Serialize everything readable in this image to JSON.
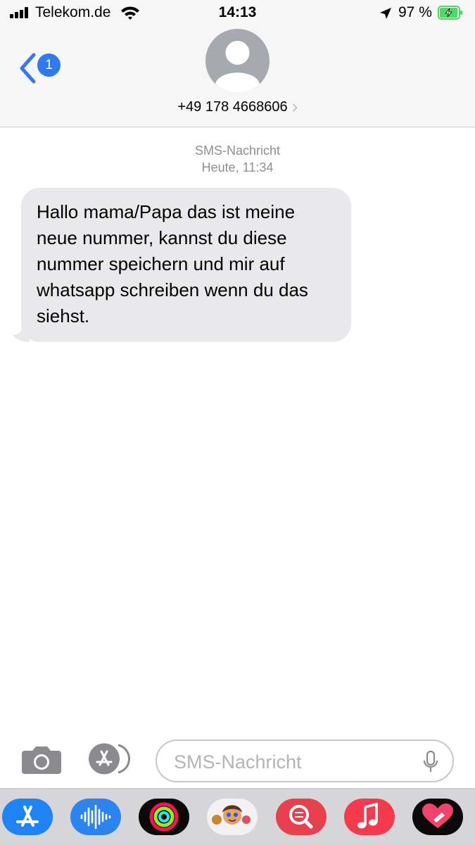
{
  "status_bar": {
    "carrier": "Telekom.de",
    "time": "14:13",
    "battery_percent": "97 %",
    "battery_level": 0.97,
    "signal_bars": 4
  },
  "header": {
    "back_badge": "1",
    "contact": "+49 178 4668606"
  },
  "conversation": {
    "service_label": "SMS-Nachricht",
    "timestamp": "Heute, 11:34",
    "messages": [
      {
        "direction": "incoming",
        "text": "Hallo mama/Papa das ist meine neue nummer, kannst du diese nummer speichern und mir auf whatsapp schreiben wenn du das siehst."
      }
    ]
  },
  "composer": {
    "placeholder": "SMS-Nachricht"
  },
  "app_drawer": {
    "apps": [
      "app-store-icon",
      "audio-message-icon",
      "activity-icon",
      "memoji-icon",
      "image-search-icon",
      "music-icon",
      "digital-touch-icon"
    ]
  },
  "colors": {
    "accent": "#2f7af0",
    "bubble_incoming": "#e9e9eb",
    "header_bg": "#f6f6f6",
    "battery_green": "#4cd964"
  }
}
